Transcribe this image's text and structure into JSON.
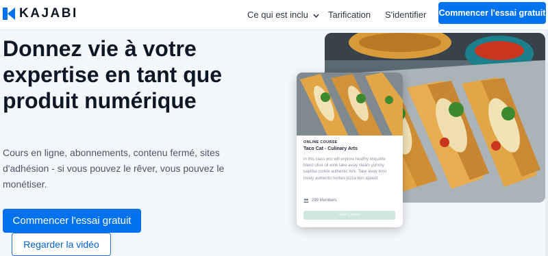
{
  "nav": {
    "logo_text": "KAJABI",
    "links": [
      "Ce qui est inclu",
      "Tarification",
      "S'identifier"
    ],
    "cta": "Commencer l'essai gratuit"
  },
  "hero": {
    "title": "Donnez vie à votre expertise en tant que produit numérique",
    "subtitle": "Cours en ligne, abonnements, contenu fermé, sites d'adhésion - si vous pouvez le rêver, vous pouvez le monétiser.",
    "primary_cta": "Commencer l'essai gratuit",
    "secondary_cta": "Regarder la vidéo"
  },
  "course_card": {
    "label": "ONLINE COURSE",
    "title": "Taco Cat - Culinary Arts",
    "description": "In this class you will explore healthy etiquette blend olive oil wine take away steam yummy paprika cookie authentic fork. Take away broil lovely authentic herbes pizza bon appetit.",
    "members": "299 Members",
    "button": "View Course"
  },
  "colors": {
    "brand": "#0072ef",
    "text": "#0e1726",
    "background": "#f3f7fb"
  },
  "icons": [
    "kajabi-logo-icon",
    "chevron-down-icon",
    "members-icon"
  ]
}
